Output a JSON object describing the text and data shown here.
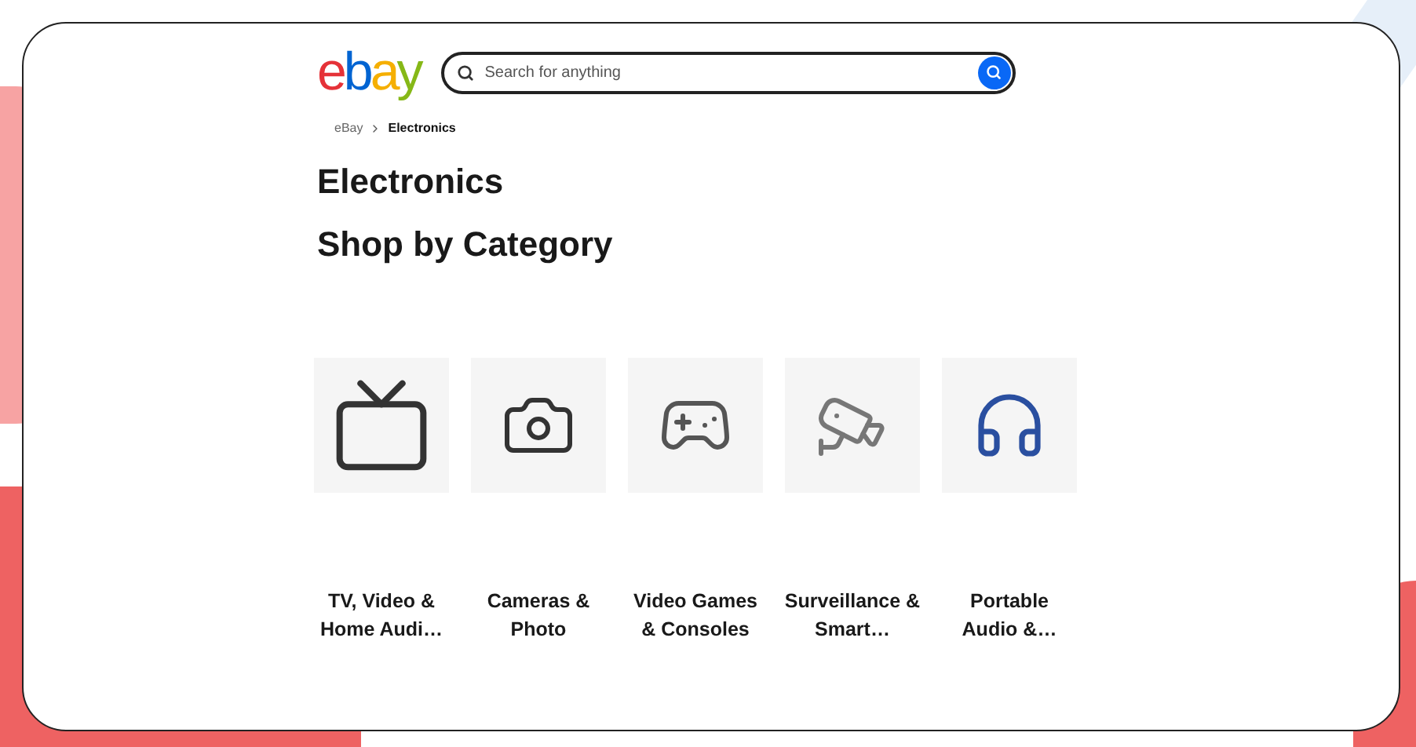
{
  "header": {
    "logo": "ebay",
    "search": {
      "placeholder": "Search for anything"
    }
  },
  "breadcrumb": [
    {
      "label": "eBay",
      "current": false
    },
    {
      "label": "Electronics",
      "current": true
    }
  ],
  "title": "Electronics",
  "section_title": "Shop by Category",
  "categories": [
    {
      "kind": "tv",
      "label": "TV, Video & Home Audi…"
    },
    {
      "kind": "camera",
      "label": "Cameras & Photo"
    },
    {
      "kind": "gaming",
      "label": "Video Games & Consoles"
    },
    {
      "kind": "security",
      "label": "Surveillance & Smart…"
    },
    {
      "kind": "headphones",
      "label": "Portable Audio &…"
    }
  ]
}
